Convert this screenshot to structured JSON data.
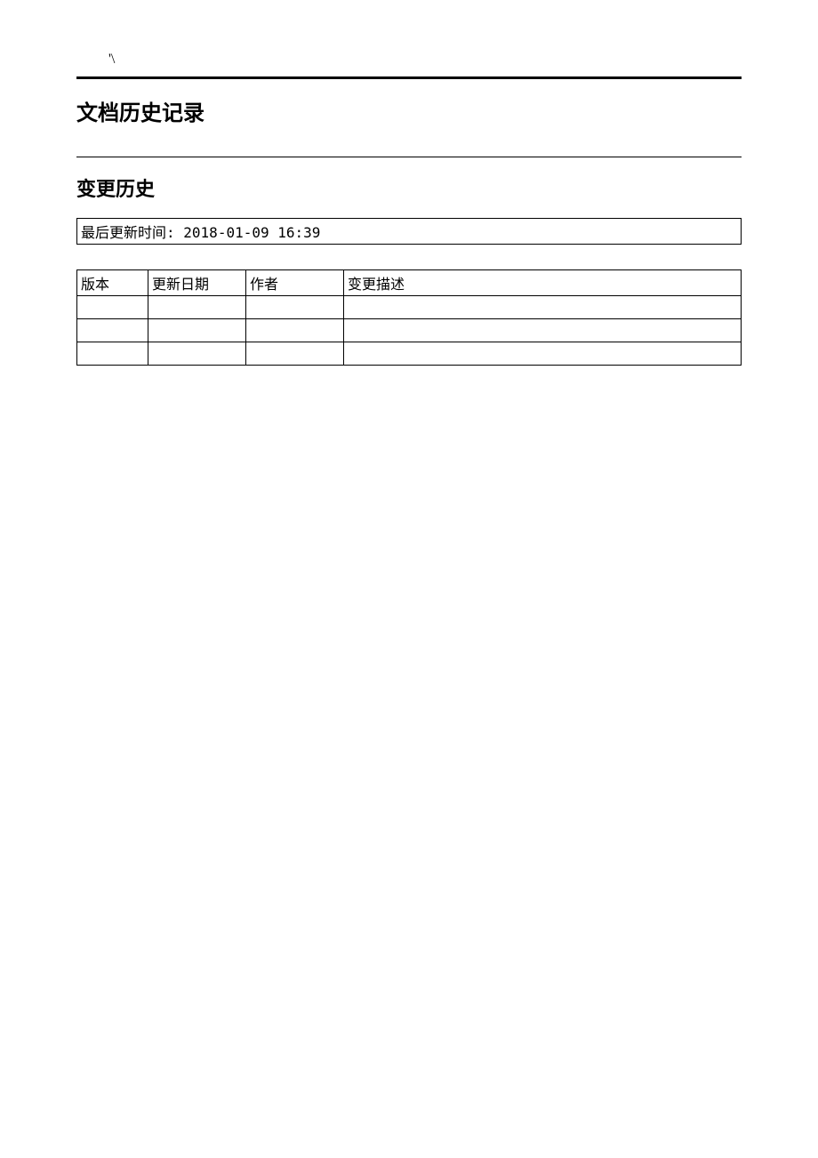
{
  "header": {
    "mark": "'\\"
  },
  "titles": {
    "main": "文档历史记录",
    "sub": "变更历史"
  },
  "update_box": {
    "label": "最后更新时间:",
    "value": "2018-01-09 16:39"
  },
  "table": {
    "headers": {
      "version": "版本",
      "date": "更新日期",
      "author": "作者",
      "desc": "变更描述"
    },
    "rows": [
      {
        "version": "",
        "date": "",
        "author": "",
        "desc": ""
      },
      {
        "version": "",
        "date": "",
        "author": "",
        "desc": ""
      },
      {
        "version": "",
        "date": "",
        "author": "",
        "desc": ""
      }
    ]
  }
}
